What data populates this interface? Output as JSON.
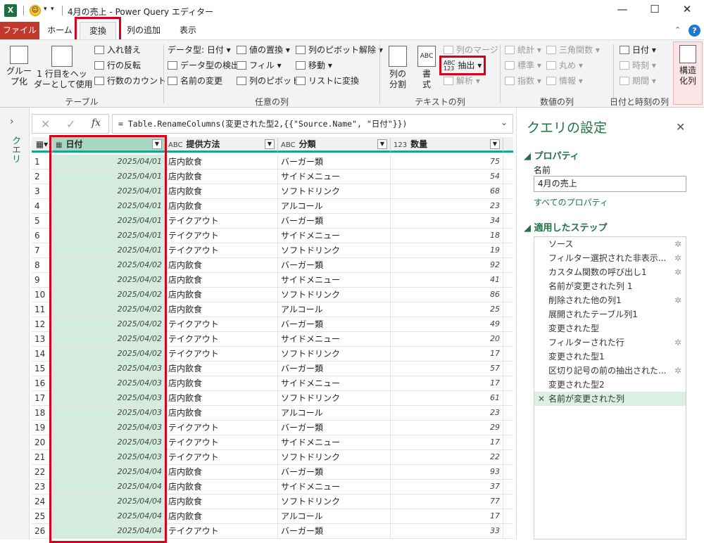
{
  "window": {
    "title": "4月の売上 - Power Query エディター",
    "app_icon": "X",
    "controls": [
      "—",
      "☐",
      "✕"
    ]
  },
  "tabs": [
    "ファイル",
    "ホーム",
    "変換",
    "列の追加",
    "表示"
  ],
  "ribbon": {
    "table_group": {
      "label": "テーブル",
      "group_by": "グルー\nプ化",
      "first_row": "1 行目をヘッ\nダーとして使用",
      "transpose": "入れ替え",
      "reverse_rows": "行の反転",
      "count_rows": "行数のカウント"
    },
    "any_column_group": {
      "label": "任意の列",
      "data_type": "データ型: 日付",
      "detect_type": "データ型の検出",
      "rename": "名前の変更",
      "replace_values": "値の置換",
      "fill": "フィル",
      "pivot": "列のピボット",
      "unpivot": "列のピボット解除",
      "move": "移動",
      "to_list": "リストに変換"
    },
    "text_column_group": {
      "label": "テキストの列",
      "split": "列の\n分割",
      "format": "書\n式",
      "merge": "列のマージ",
      "extract": "抽出",
      "parse": "解析"
    },
    "number_column_group": {
      "label": "数値の列",
      "statistics": "統計",
      "standard": "標準",
      "scientific": "指数",
      "trigonometry": "三角関数",
      "rounding": "丸め",
      "information": "情報"
    },
    "datetime_group": {
      "label": "日付と時刻の列",
      "date": "日付",
      "time": "時刻",
      "duration": "期間"
    },
    "structured": {
      "label": "構造\n化列"
    }
  },
  "query_pane": {
    "label": "クエリ"
  },
  "formula_bar": {
    "fx": "fx",
    "formula": "= Table.RenameColumns(変更された型2,{{\"Source.Name\", \"日付\"}})"
  },
  "table": {
    "columns": [
      {
        "type": "▦",
        "name": "日付"
      },
      {
        "type": "ABC",
        "name": "提供方法"
      },
      {
        "type": "ABC",
        "name": "分類"
      },
      {
        "type": "123",
        "name": "数量"
      }
    ],
    "rows": [
      [
        "1",
        "2025/04/01",
        "店内飲食",
        "バーガー類",
        "75"
      ],
      [
        "2",
        "2025/04/01",
        "店内飲食",
        "サイドメニュー",
        "54"
      ],
      [
        "3",
        "2025/04/01",
        "店内飲食",
        "ソフトドリンク",
        "68"
      ],
      [
        "4",
        "2025/04/01",
        "店内飲食",
        "アルコール",
        "23"
      ],
      [
        "5",
        "2025/04/01",
        "テイクアウト",
        "バーガー類",
        "34"
      ],
      [
        "6",
        "2025/04/01",
        "テイクアウト",
        "サイドメニュー",
        "18"
      ],
      [
        "7",
        "2025/04/01",
        "テイクアウト",
        "ソフトドリンク",
        "19"
      ],
      [
        "8",
        "2025/04/02",
        "店内飲食",
        "バーガー類",
        "92"
      ],
      [
        "9",
        "2025/04/02",
        "店内飲食",
        "サイドメニュー",
        "41"
      ],
      [
        "10",
        "2025/04/02",
        "店内飲食",
        "ソフトドリンク",
        "86"
      ],
      [
        "11",
        "2025/04/02",
        "店内飲食",
        "アルコール",
        "25"
      ],
      [
        "12",
        "2025/04/02",
        "テイクアウト",
        "バーガー類",
        "49"
      ],
      [
        "13",
        "2025/04/02",
        "テイクアウト",
        "サイドメニュー",
        "20"
      ],
      [
        "14",
        "2025/04/02",
        "テイクアウト",
        "ソフトドリンク",
        "17"
      ],
      [
        "15",
        "2025/04/03",
        "店内飲食",
        "バーガー類",
        "57"
      ],
      [
        "16",
        "2025/04/03",
        "店内飲食",
        "サイドメニュー",
        "17"
      ],
      [
        "17",
        "2025/04/03",
        "店内飲食",
        "ソフトドリンク",
        "61"
      ],
      [
        "18",
        "2025/04/03",
        "店内飲食",
        "アルコール",
        "23"
      ],
      [
        "19",
        "2025/04/03",
        "テイクアウト",
        "バーガー類",
        "29"
      ],
      [
        "20",
        "2025/04/03",
        "テイクアウト",
        "サイドメニュー",
        "17"
      ],
      [
        "21",
        "2025/04/03",
        "テイクアウト",
        "ソフトドリンク",
        "22"
      ],
      [
        "22",
        "2025/04/04",
        "店内飲食",
        "バーガー類",
        "93"
      ],
      [
        "23",
        "2025/04/04",
        "店内飲食",
        "サイドメニュー",
        "37"
      ],
      [
        "24",
        "2025/04/04",
        "店内飲食",
        "ソフトドリンク",
        "77"
      ],
      [
        "25",
        "2025/04/04",
        "店内飲食",
        "アルコール",
        "17"
      ],
      [
        "26",
        "2025/04/04",
        "テイクアウト",
        "バーガー類",
        "33"
      ]
    ]
  },
  "settings": {
    "title": "クエリの設定",
    "properties_header": "プロパティ",
    "name_label": "名前",
    "name_value": "4月の売上",
    "all_properties": "すべてのプロパティ",
    "steps_header": "適用したステップ",
    "steps": [
      {
        "label": "ソース",
        "gear": true
      },
      {
        "label": "フィルター選択された非表示...",
        "gear": true
      },
      {
        "label": "カスタム関数の呼び出し1",
        "gear": true
      },
      {
        "label": "名前が変更された列 1",
        "gear": false
      },
      {
        "label": "削除された他の列1",
        "gear": true
      },
      {
        "label": "展開されたテーブル列1",
        "gear": false
      },
      {
        "label": "変更された型",
        "gear": false
      },
      {
        "label": "フィルターされた行",
        "gear": true
      },
      {
        "label": "変更された型1",
        "gear": false
      },
      {
        "label": "区切り記号の前の抽出された...",
        "gear": true
      },
      {
        "label": "変更された型2",
        "gear": false
      },
      {
        "label": "名前が変更された列",
        "gear": false,
        "selected": true
      }
    ]
  },
  "colors": {
    "file_tab": "#c0392b",
    "highlight": "#d8001c",
    "accent": "#1aa58c",
    "selected_column": "#d4ecdf",
    "settings_title": "#217346"
  }
}
